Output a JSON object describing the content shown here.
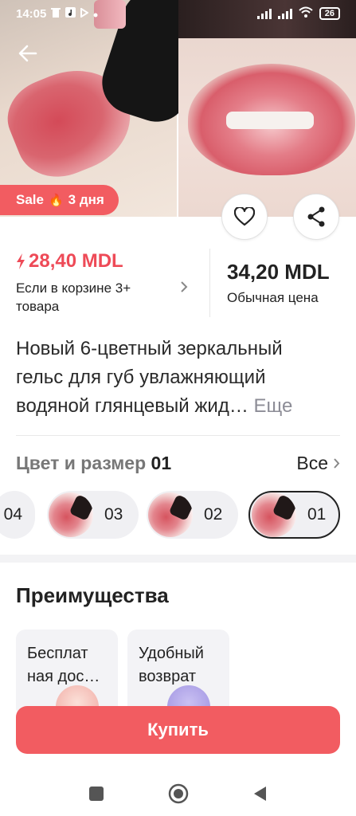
{
  "status_bar": {
    "time": "14:05",
    "battery": "26"
  },
  "hero": {
    "sale_badge_label": "Sale",
    "sale_badge_days": "3 дня",
    "fire_emoji": "🔥"
  },
  "price": {
    "sale_price": "28,40 MDL",
    "sale_condition": "Если в корзине 3+ товара",
    "regular_price": "34,20 MDL",
    "regular_label": "Обычная цена"
  },
  "product": {
    "title": "Новый 6-цветный зеркальный гельс для губ увлажняющий водяной глянцевый жид…",
    "more_label": "Еще"
  },
  "color_size": {
    "label": "Цвет и размер",
    "selected": "01",
    "all_label": "Все",
    "variants": [
      {
        "num": "04"
      },
      {
        "num": "03"
      },
      {
        "num": "02"
      },
      {
        "num": "01"
      }
    ]
  },
  "advantages": {
    "title": "Преимущества",
    "cards": [
      {
        "text": "Бесплат ная дос…"
      },
      {
        "text": "Удобный возврат"
      }
    ]
  },
  "buy_button": {
    "label": "Купить"
  },
  "icons": {
    "back": "arrow-left-icon",
    "favorite": "heart-icon",
    "share": "share-icon",
    "bolt": "lightning-icon",
    "chevron": "chevron-right-icon"
  },
  "colors": {
    "accent": "#f25c61",
    "price_red": "#ee4a57",
    "muted": "#8c8c96"
  }
}
